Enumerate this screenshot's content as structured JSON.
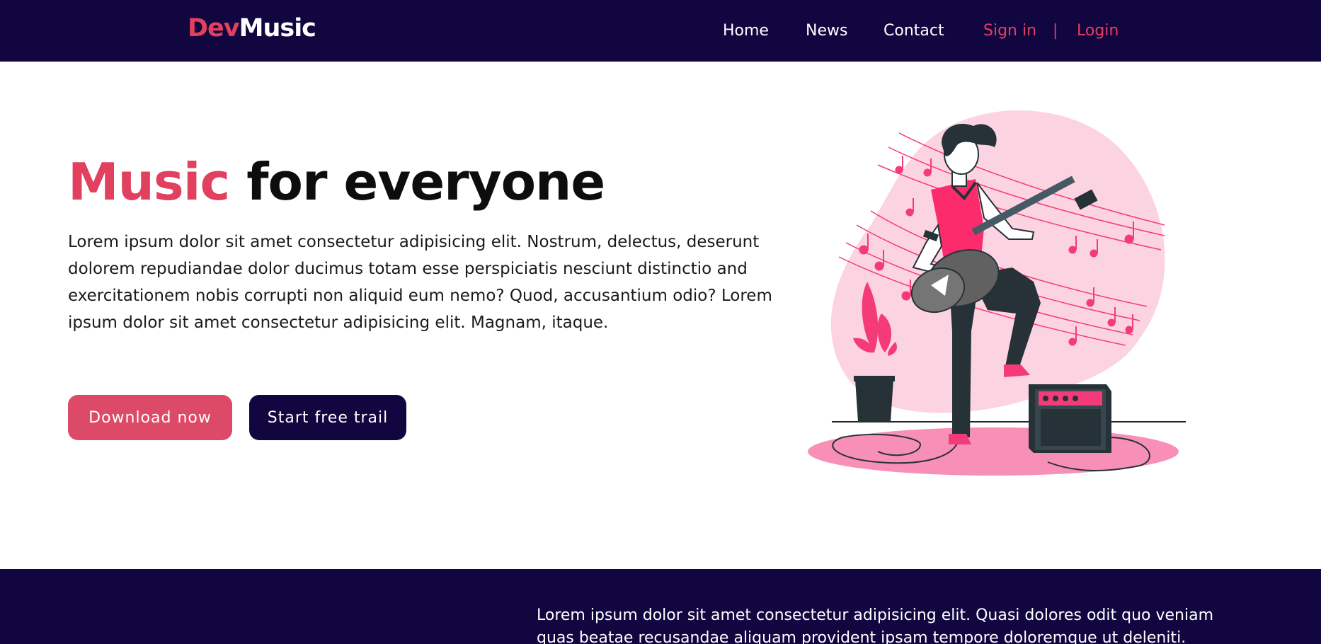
{
  "brand": {
    "part1": "Dev",
    "part2": "Music"
  },
  "nav": {
    "home": "Home",
    "news": "News",
    "contact": "Contact",
    "sign_in": "Sign in",
    "separator": "|",
    "login": "Login"
  },
  "hero": {
    "title_accent": "Music",
    "title_rest": " for everyone",
    "description": "Lorem ipsum dolor sit amet consectetur adipisicing elit. Nostrum, delectus, deserunt dolorem repudiandae dolor ducimus totam esse perspiciatis nesciunt distinctio and exercitationem nobis corrupti non aliquid eum nemo? Quod, accusantium odio? Lorem ipsum dolor sit amet consectetur adipisicing elit. Magnam, itaque.",
    "download_button": "Download now",
    "trial_button": "Start free trail"
  },
  "bottom": {
    "text": "Lorem ipsum dolor sit amet consectetur adipisicing elit. Quasi dolores odit quo veniam quas beatae recusandae aliquam provident ipsam tempore doloremque ut deleniti."
  },
  "colors": {
    "navy": "#110640",
    "accent": "#e2405f",
    "button_pink": "#dd4a67",
    "blob_pink": "#fcd3e1",
    "shirt_pink": "#fb2b6c"
  },
  "icons": {
    "illustration": "guitarist-illustration"
  }
}
